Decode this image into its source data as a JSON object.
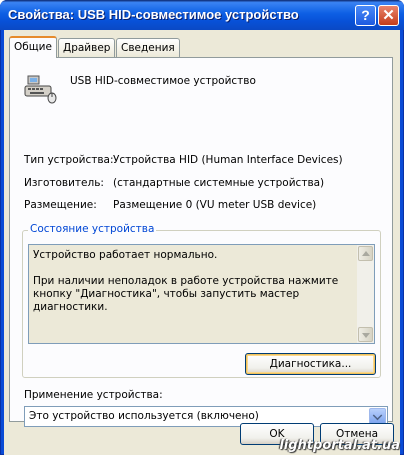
{
  "window": {
    "title": "Свойства: USB HID-совместимое устройство",
    "help_button": "?",
    "close_button": "✕"
  },
  "tabs": [
    {
      "label": "Общие",
      "active": true
    },
    {
      "label": "Драйвер",
      "active": false
    },
    {
      "label": "Сведения",
      "active": false
    }
  ],
  "device": {
    "icon": "usb-hid-device-icon",
    "name": "USB HID-совместимое устройство"
  },
  "properties": [
    {
      "label": "Тип устройства:",
      "value": "Устройства HID (Human Interface Devices)"
    },
    {
      "label": "Изготовитель:",
      "value": "(стандартные системные устройства)"
    },
    {
      "label": "Размещение:",
      "value": "Размещение 0 (VU meter USB device)"
    }
  ],
  "status": {
    "group_title": "Состояние устройства",
    "line1": "Устройство работает нормально.",
    "line2": "При наличии неполадок в работе устройства нажмите кнопку \"Диагностика\", чтобы запустить мастер диагностики.",
    "diagnostics_button": "Диагностика..."
  },
  "usage": {
    "label": "Применение устройства:",
    "selected": "Это устройство используется (включено)"
  },
  "footer": {
    "ok_button": "OK",
    "cancel_button": "Отмена"
  },
  "watermark": "lightportal.at.ua"
}
